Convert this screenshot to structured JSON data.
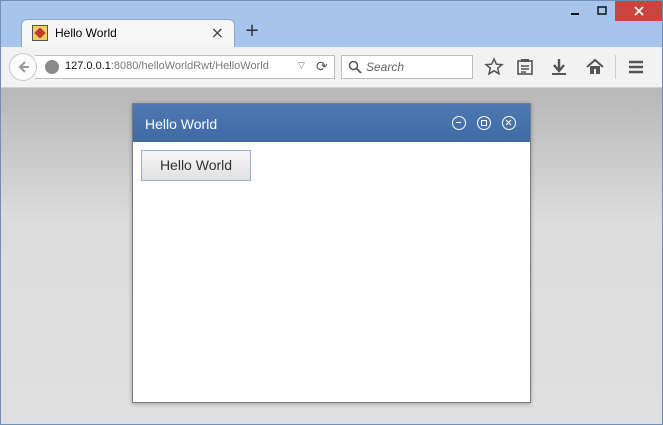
{
  "browser": {
    "tab": {
      "title": "Hello World"
    },
    "new_tab_label": "+",
    "url": {
      "host": "127.0.0.1",
      "rest": ":8080/helloWorldRwt/HelloWorld"
    },
    "search_placeholder": "Search"
  },
  "dialog": {
    "title": "Hello World",
    "button_label": "Hello World"
  }
}
